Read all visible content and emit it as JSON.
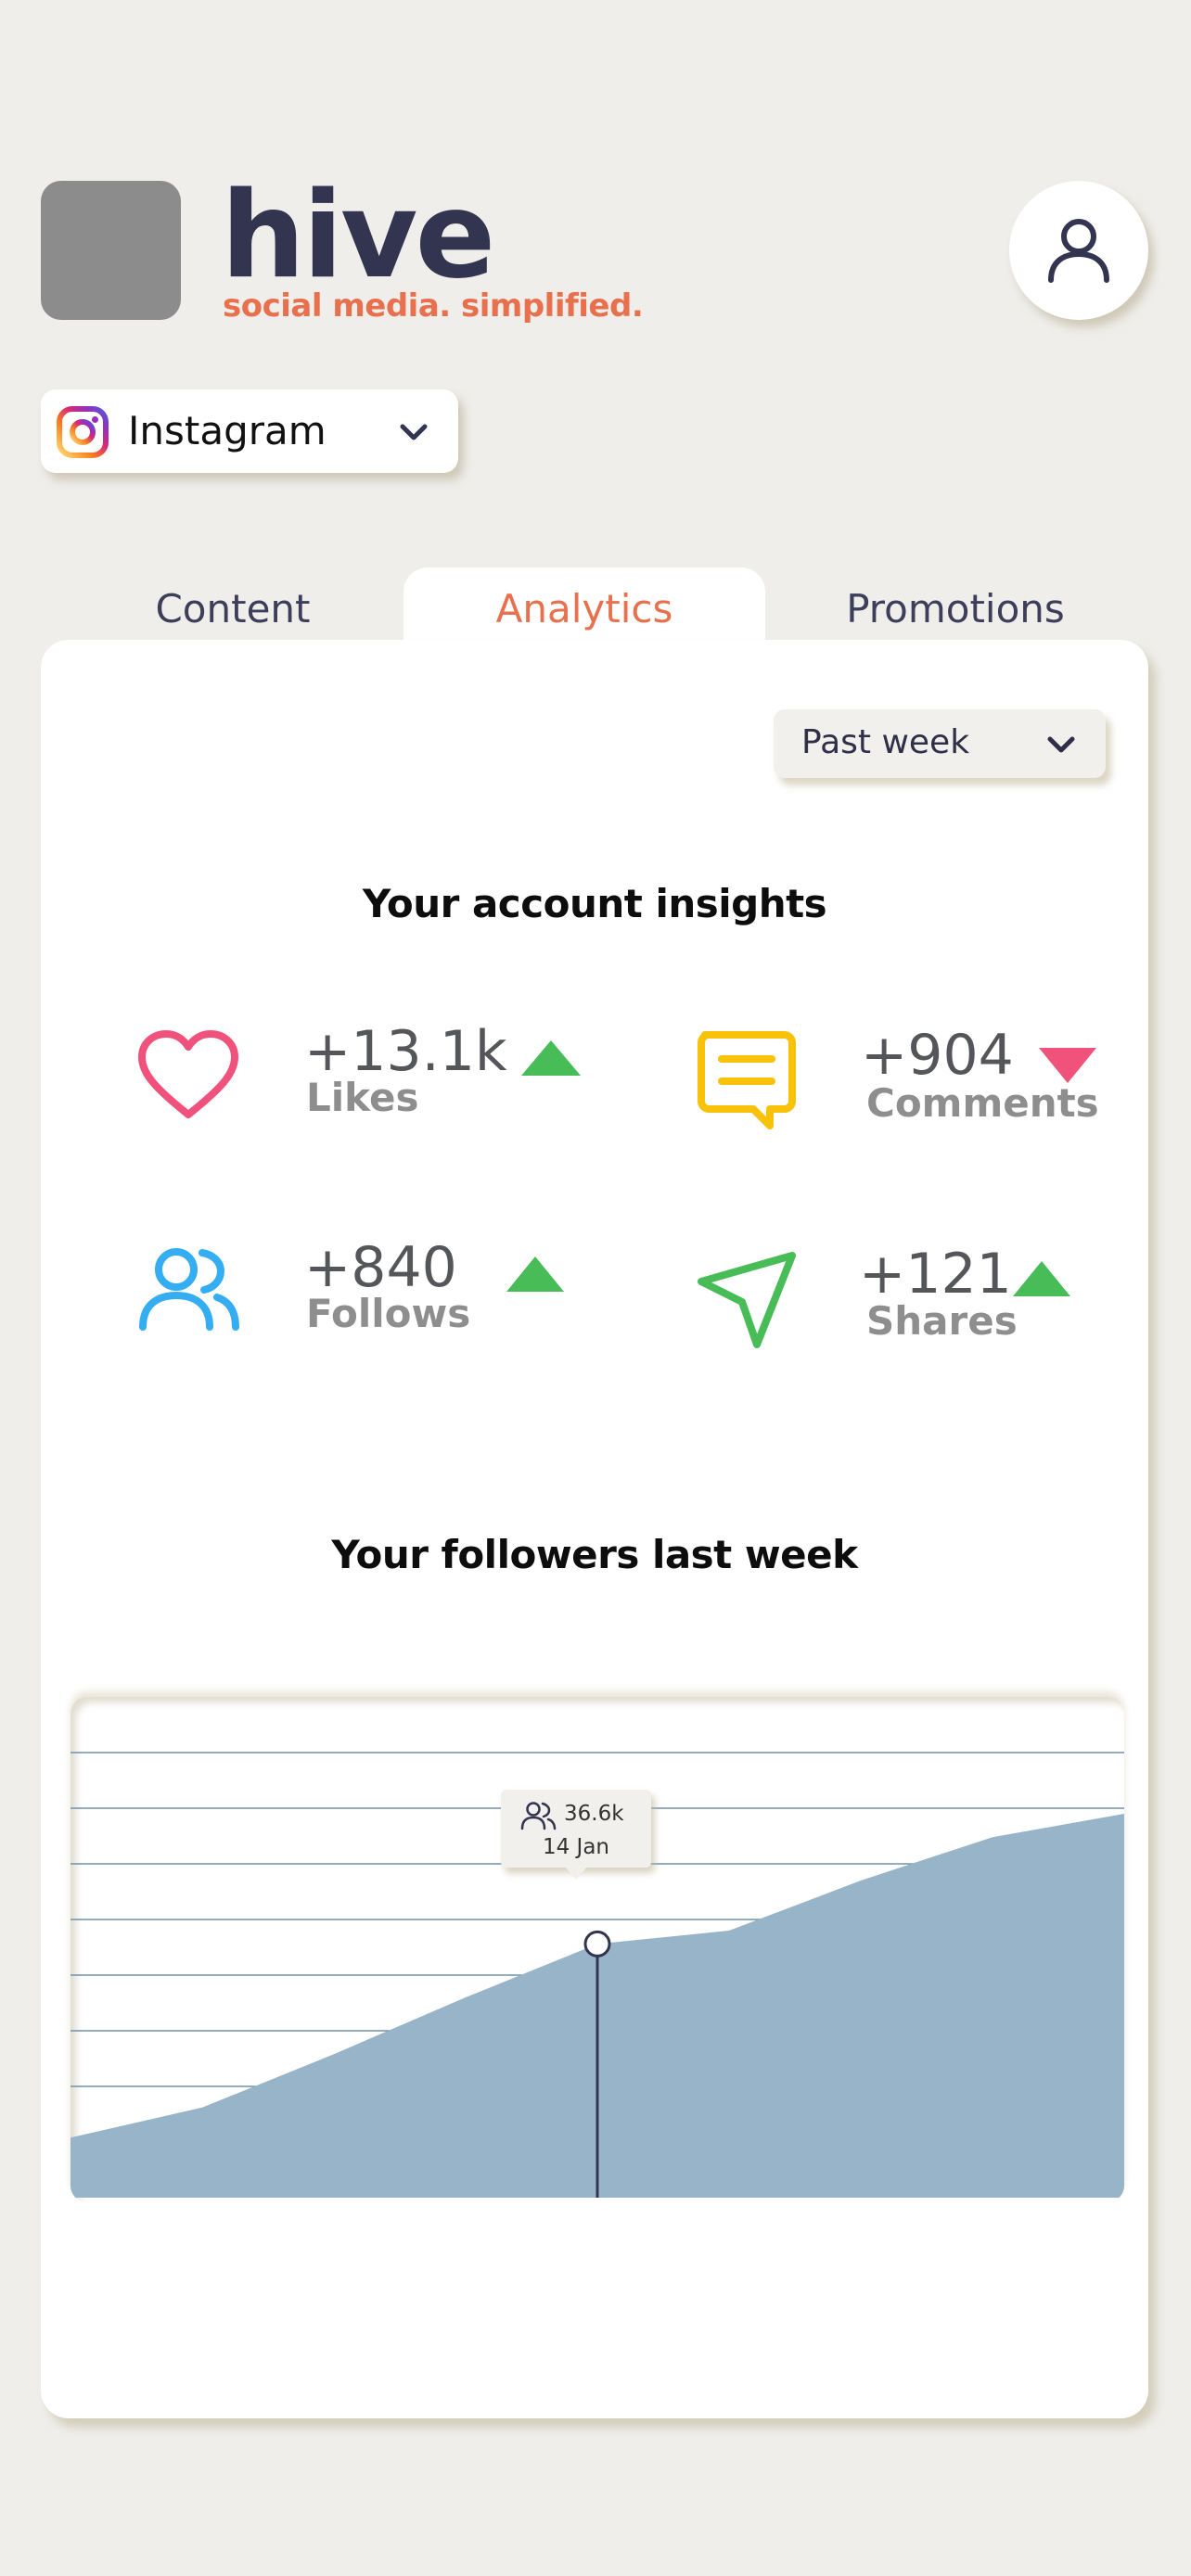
{
  "header": {
    "app_name": "hive",
    "tagline": "social media. simplified.",
    "logo_icon": "logo-placeholder",
    "avatar_icon": "user-icon"
  },
  "platform_select": {
    "value": "Instagram",
    "icon": "instagram-icon"
  },
  "tabs": [
    {
      "label": "Content",
      "active": false
    },
    {
      "label": "Analytics",
      "active": true
    },
    {
      "label": "Promotions",
      "active": false
    }
  ],
  "analytics": {
    "period": "Past week",
    "insights_title": "Your account insights",
    "metrics": [
      {
        "value": "+13.1k",
        "label": "Likes",
        "icon": "heart-icon",
        "trend": "up"
      },
      {
        "value": "+904",
        "label": "Comments",
        "icon": "comment-icon",
        "trend": "down"
      },
      {
        "value": "+840",
        "label": "Follows",
        "icon": "users-icon",
        "trend": "up"
      },
      {
        "value": "+121",
        "label": "Shares",
        "icon": "send-icon",
        "trend": "up"
      }
    ],
    "followers_title": "Your followers last week",
    "tooltip": {
      "value": "36.6k",
      "date": "14 Jan"
    }
  },
  "colors": {
    "accent": "#e8704d",
    "trend_up": "#48bd57",
    "trend_down": "#f0527c",
    "heart": "#f0527c",
    "comment": "#f9c20a",
    "users": "#35adf2",
    "send": "#48bd57",
    "area_fill": "#98b4c8",
    "grid": "#6e92aa"
  },
  "chart_data": {
    "type": "area",
    "title": "Your followers last week",
    "x": [
      0,
      1,
      2,
      3,
      4,
      5,
      6,
      7,
      8
    ],
    "values": [
      30.8,
      31.7,
      33.3,
      35.0,
      36.6,
      37.0,
      38.5,
      39.8,
      40.5
    ],
    "ylim": [
      29,
      44
    ],
    "grid": true,
    "highlight": {
      "index": 4,
      "value": "36.6k",
      "date": "14 Jan"
    }
  }
}
